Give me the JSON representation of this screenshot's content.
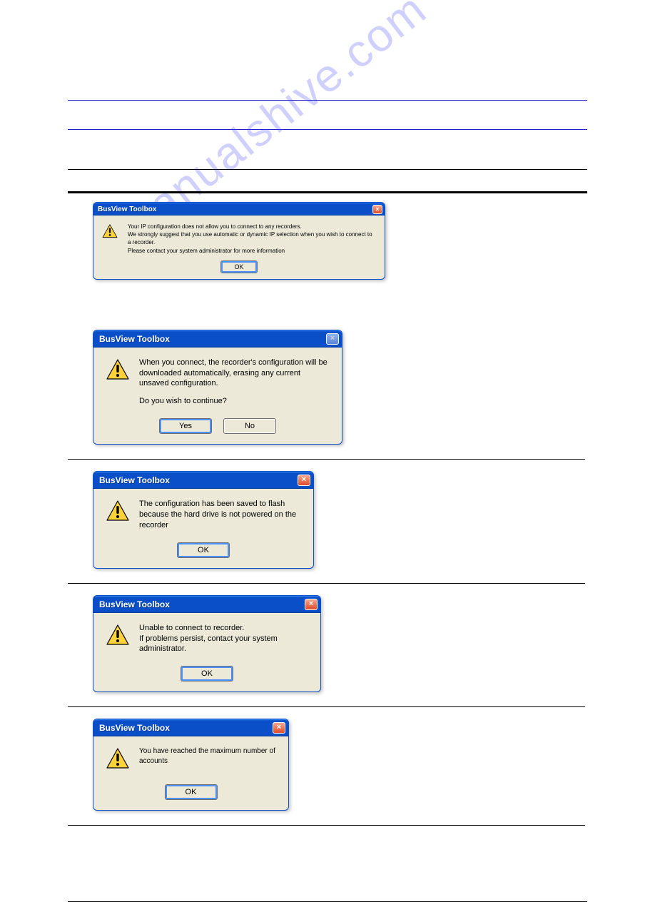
{
  "watermark": "manualshive.com",
  "dialogs": [
    {
      "title": "BusView Toolbox",
      "lines": [
        "Your IP configuration does not allow you to connect to any recorders.",
        "We strongly suggest that you use automatic or dynamic IP selection when you wish to connect to a recorder.",
        "Please contact your system administrator for more information"
      ],
      "buttons": {
        "ok": "OK"
      }
    },
    {
      "title": "BusView Toolbox",
      "lines": [
        "When you connect, the recorder's configuration will be downloaded automatically, erasing any current unsaved configuration."
      ],
      "question": "Do you wish to continue?",
      "buttons": {
        "yes": "Yes",
        "no": "No"
      }
    },
    {
      "title": "BusView Toolbox",
      "lines": [
        "The configuration has been saved to flash",
        "because the hard drive is not powered on the recorder"
      ],
      "buttons": {
        "ok": "OK"
      }
    },
    {
      "title": "BusView Toolbox",
      "lines": [
        "Unable to connect to recorder.",
        "If problems persist, contact your system administrator."
      ],
      "buttons": {
        "ok": "OK"
      }
    },
    {
      "title": "BusView Toolbox",
      "lines": [
        "You have reached the maximum number of accounts"
      ],
      "buttons": {
        "ok": "OK"
      }
    }
  ]
}
